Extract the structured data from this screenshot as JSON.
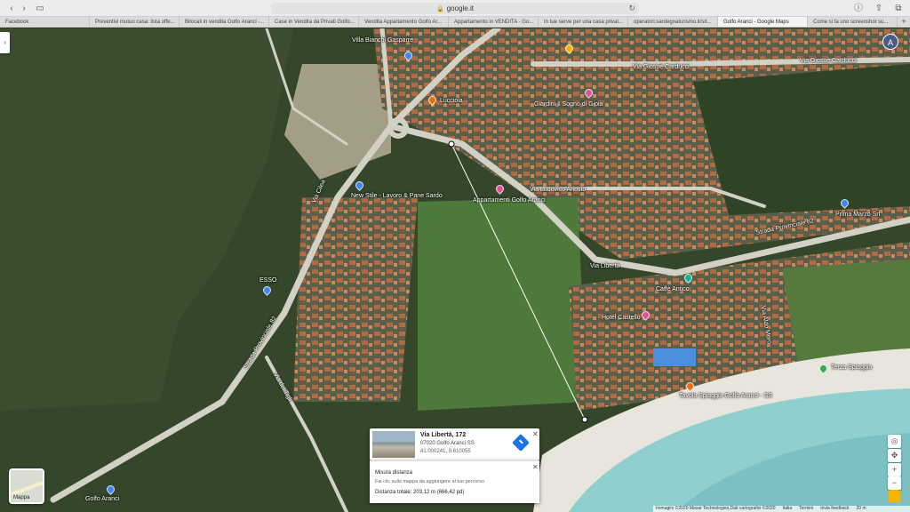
{
  "browser": {
    "url": "google.it",
    "tabs": [
      {
        "label": "Facebook",
        "active": false
      },
      {
        "label": "Preventivi mutuo casa: lista offe...",
        "active": false
      },
      {
        "label": "Bilocali in vendita Golfo Aranci -...",
        "active": false
      },
      {
        "label": "Case in Vendita da Privati Golfo...",
        "active": false
      },
      {
        "label": "Vendita Appartamento Golfo Ar...",
        "active": false
      },
      {
        "label": "Appartamento in VENDITA - Go...",
        "active": false
      },
      {
        "label": "In tue serve per una casa privat...",
        "active": false
      },
      {
        "label": "operatori.sardegnaturismo.it/sit...",
        "active": false
      },
      {
        "label": "Golfo Aranci - Google Maps",
        "active": true
      },
      {
        "label": "Come si fa uno screenshot su...",
        "active": false
      }
    ]
  },
  "map": {
    "avatar_letter": "A",
    "layers_label": "Mappa",
    "labels": {
      "villa": "Villa Bianchi Gasparre",
      "carducci1": "Via Giosuè Carducci",
      "carducci2": "Via Giosuè Carducci",
      "giardini": "Giardini Il Sogno di Gioia",
      "lucciola": "Lucciola",
      "via_ludovico": "Via Ludovico Ariosto",
      "appartamenti": "Appartamenti Golfo Aranci",
      "new_stile": "New Stile - Lavoro & Pane Sardo",
      "via_libertà": "Via Libertà",
      "hotel": "Hotel Castello",
      "caffe": "Caffè Antico",
      "prima": "Prima Marzo Srl",
      "terza": "Terza Spiaggia",
      "tavola": "Tavola Spiaggia Golfo Aranci - SS",
      "strada_prov": "Strada Provinciale 82",
      "via_cilea": "Via Cilea",
      "via_dei_tigli": "Via dei Tigli",
      "via_sp": "Strada Provinciale 82",
      "via_aldo": "Via Aldo Moro",
      "golf": "Golfo Aranci",
      "eso": "ESSO"
    },
    "footer": [
      "Immagini ©2020 Maxar Technologies,Dati cartografici ©2020",
      "Italia",
      "Termini",
      "Invia feedback",
      "20 m"
    ]
  },
  "place_card": {
    "title": "Via Libertà, 172",
    "address": "07020 Golfo Aranci SS",
    "coords": "41.000241, 9.610055"
  },
  "measure": {
    "title": "Misura distanza",
    "help": "Fai clic sulla mappa da aggiungere al tuo percorso",
    "total": "Distanza totale: 203,12 m (666,42 pd)"
  }
}
